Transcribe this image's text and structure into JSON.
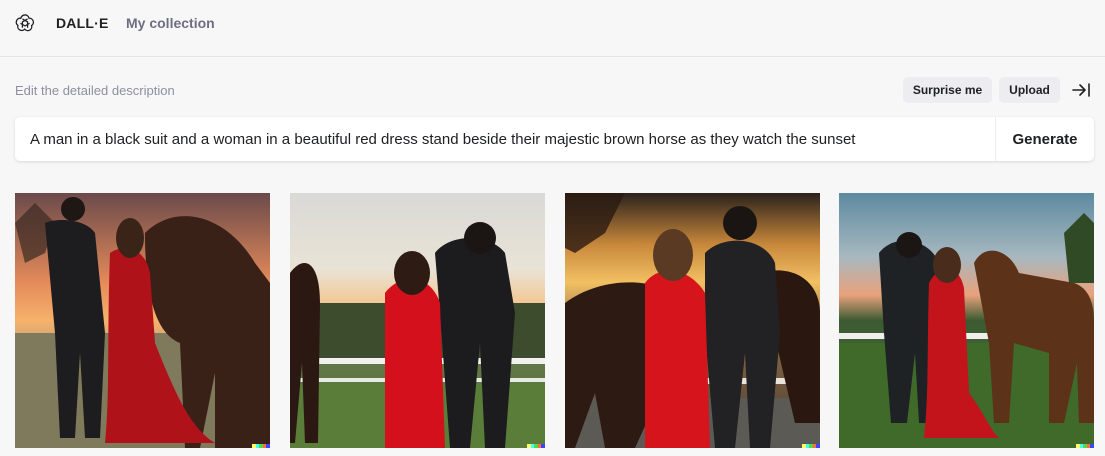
{
  "header": {
    "brand": "DALL·E",
    "nav_collection": "My collection"
  },
  "editor": {
    "label": "Edit the detailed description",
    "surprise_label": "Surprise me",
    "upload_label": "Upload",
    "prompt_value": "A man in a black suit and a woman in a beautiful red dress stand beside their majestic brown horse as they watch the sunset",
    "generate_label": "Generate"
  },
  "colors": {
    "watermark": [
      "#ffff66",
      "#42ffff",
      "#51da4c",
      "#ff6e3c",
      "#3c46ff"
    ]
  },
  "icons": {
    "logo": "openai-logo-icon",
    "collapse": "collapse-right-icon"
  }
}
